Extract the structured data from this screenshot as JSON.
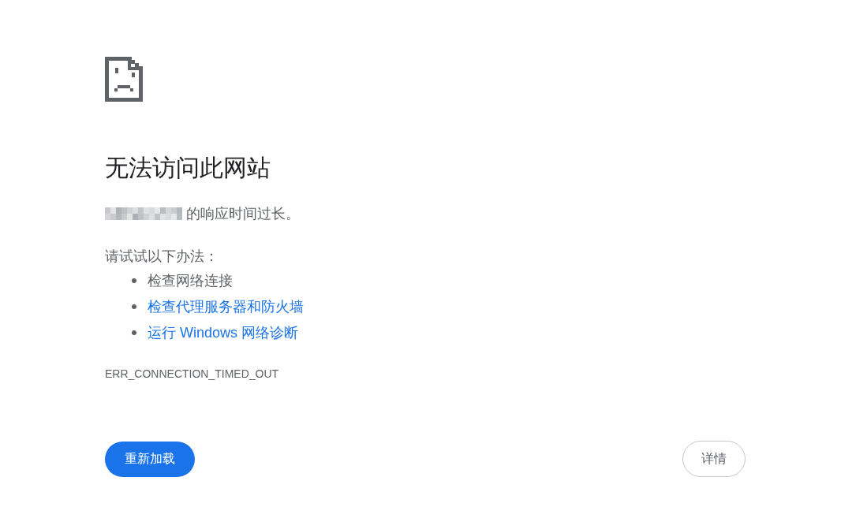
{
  "heading": "无法访问此网站",
  "message": "的响应时间过长。",
  "suggestions_intro": "请试试以下办法：",
  "suggestions": [
    {
      "text": "检查网络连接",
      "kind": "plain"
    },
    {
      "text": "检查代理服务器和防火墙",
      "kind": "link"
    },
    {
      "text": "运行 Windows 网络诊断",
      "kind": "link"
    }
  ],
  "error_code": "ERR_CONNECTION_TIMED_OUT",
  "buttons": [
    {
      "label": "重新加载",
      "kind": "primary"
    },
    {
      "label": "详情",
      "kind": "secondary"
    }
  ]
}
